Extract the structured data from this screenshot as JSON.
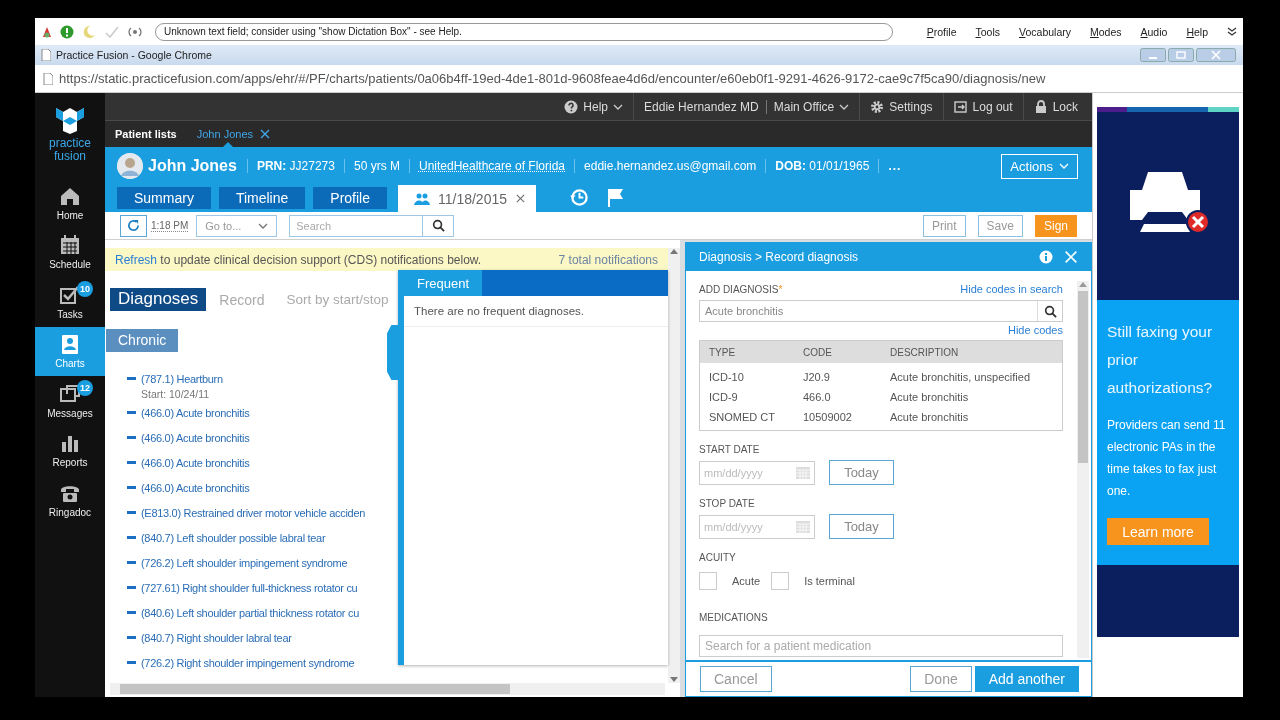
{
  "dictation_bar": {
    "message": "Unknown text field; consider using \"show Dictation Box\" - see Help.",
    "menu": [
      "Profile",
      "Tools",
      "Vocabulary",
      "Modes",
      "Audio",
      "Help"
    ]
  },
  "browser": {
    "title": "Practice Fusion - Google Chrome",
    "url": "https://static.practicefusion.com/apps/ehr/#/PF/charts/patients/0a06b4ff-19ed-4de1-801d-9608feae4d6d/encounter/e60eb0f1-9291-4626-9172-cae9c7f5ca90/diagnosis/new"
  },
  "logo": {
    "text": "practice fusion"
  },
  "nav": [
    {
      "kind": "home",
      "label": "Home",
      "selected": false
    },
    {
      "kind": "schedule",
      "label": "Schedule",
      "selected": false
    },
    {
      "kind": "tasks",
      "label": "Tasks",
      "selected": false,
      "badge": "10"
    },
    {
      "kind": "charts",
      "label": "Charts",
      "selected": true
    },
    {
      "kind": "messages",
      "label": "Messages",
      "selected": false,
      "badge": "12"
    },
    {
      "kind": "reports",
      "label": "Reports",
      "selected": false
    },
    {
      "kind": "ringadoc",
      "label": "Ringadoc",
      "selected": false
    }
  ],
  "top_bar": [
    {
      "kind": "help",
      "label": "Help"
    },
    {
      "kind": "user",
      "label": "Eddie Hernandez MD"
    },
    {
      "kind": "office",
      "label": "Main Office"
    },
    {
      "kind": "settings",
      "label": "Settings"
    },
    {
      "kind": "logout",
      "label": "Log out"
    },
    {
      "kind": "lock",
      "label": "Lock"
    }
  ],
  "patient_tabs": [
    {
      "label": "Patient lists",
      "selected": false
    },
    {
      "label": "John Jones",
      "selected": true
    }
  ],
  "patient": {
    "name": "John Jones",
    "fields": [
      {
        "kind": "text",
        "text": "**PRN:** JJ27273"
      },
      {
        "kind": "text",
        "text": "50 yrs M"
      },
      {
        "kind": "link",
        "text": "UnitedHealthcare of Florida"
      },
      {
        "kind": "text",
        "text": "eddie.hernandez.us@gmail.com"
      },
      {
        "kind": "text",
        "text": "**DOB:** 01/01/1965"
      },
      {
        "kind": "more",
        "text": "..."
      }
    ],
    "actions": "Actions"
  },
  "chart_tabs": [
    {
      "label": "Summary",
      "selected": false
    },
    {
      "label": "Timeline",
      "selected": false
    },
    {
      "label": "Profile",
      "selected": false
    },
    {
      "label": "11/18/2015",
      "selected": true
    }
  ],
  "toolbar": {
    "time": "1:18 PM",
    "goto": "Go to...",
    "search_placeholder": "Search",
    "buttons": [
      {
        "kind": "outline",
        "label": "Print"
      },
      {
        "kind": "outline",
        "label": "Save"
      },
      {
        "kind": "primary",
        "label": "Sign"
      }
    ]
  },
  "notification": {
    "link": "Refresh",
    "text": "to update clinical decision support (CDS) notifications below.",
    "count": "7 total notifications"
  },
  "diagnoses": {
    "tabs": [
      {
        "label": "Diagnoses",
        "selected": true
      },
      {
        "label": "Record",
        "selected": false
      },
      {
        "label": "Sort by start/stop",
        "selected": false
      }
    ],
    "group": "Chronic",
    "items": [
      {
        "text": "(787.1) Heartburn",
        "start": "Start: 10/24/11"
      },
      {
        "text": "(466.0) Acute bronchitis"
      },
      {
        "text": "(466.0) Acute bronchitis"
      },
      {
        "text": "(466.0) Acute bronchitis"
      },
      {
        "text": "(466.0) Acute bronchitis"
      },
      {
        "text": "(E813.0) Restrained driver motor vehicle acciden"
      },
      {
        "text": "(840.7) Left shoulder possible labral tear"
      },
      {
        "text": "(726.2) Left shoulder impingement syndrome"
      },
      {
        "text": "(727.61) Right shoulder full-thickness rotator cu"
      },
      {
        "text": "(840.6) Left shoulder partial thickness rotator cu"
      },
      {
        "text": "(840.7) Right shoulder labral tear"
      },
      {
        "text": "(726.2) Right shoulder impingement syndrome"
      }
    ]
  },
  "frequent_panel": {
    "tab": "Frequent",
    "message": "There are no frequent diagnoses."
  },
  "dialog": {
    "title": "Diagnosis > Record diagnosis",
    "add_label": "ADD DIAGNOSIS",
    "required": "*",
    "hide_codes_in_search": "Hide codes in search",
    "search_value": "Acute bronchitis",
    "hide_codes": "Hide codes",
    "codes": {
      "columns": [
        "TYPE",
        "CODE",
        "DESCRIPTION"
      ],
      "rows": [
        [
          "ICD-10",
          "J20.9",
          "Acute bronchitis, unspecified"
        ],
        [
          "ICD-9",
          "466.0",
          "Acute bronchitis"
        ],
        [
          "SNOMED CT",
          "10509002",
          "Acute bronchitis"
        ]
      ]
    },
    "dates": [
      {
        "label": "START DATE",
        "placeholder": "mm/dd/yyyy",
        "button": "Today"
      },
      {
        "label": "STOP DATE",
        "placeholder": "mm/dd/yyyy",
        "button": "Today"
      }
    ],
    "acuity_label": "ACUITY",
    "acuity": [
      {
        "label": "Acute",
        "checked": false
      },
      {
        "label": "Is terminal",
        "checked": false
      }
    ],
    "medications_label": "MEDICATIONS",
    "medications_placeholder": "Search for a patient medication",
    "buttons": [
      {
        "kind": "outline",
        "label": "Cancel"
      },
      {
        "kind": "outline",
        "label": "Done"
      },
      {
        "kind": "primary",
        "label": "Add another"
      }
    ]
  },
  "ad": {
    "headline": "Still faxing your prior authorizations?",
    "body": "Providers can send 11 electronic PAs in the time takes to fax just one.",
    "button": "Learn more"
  }
}
